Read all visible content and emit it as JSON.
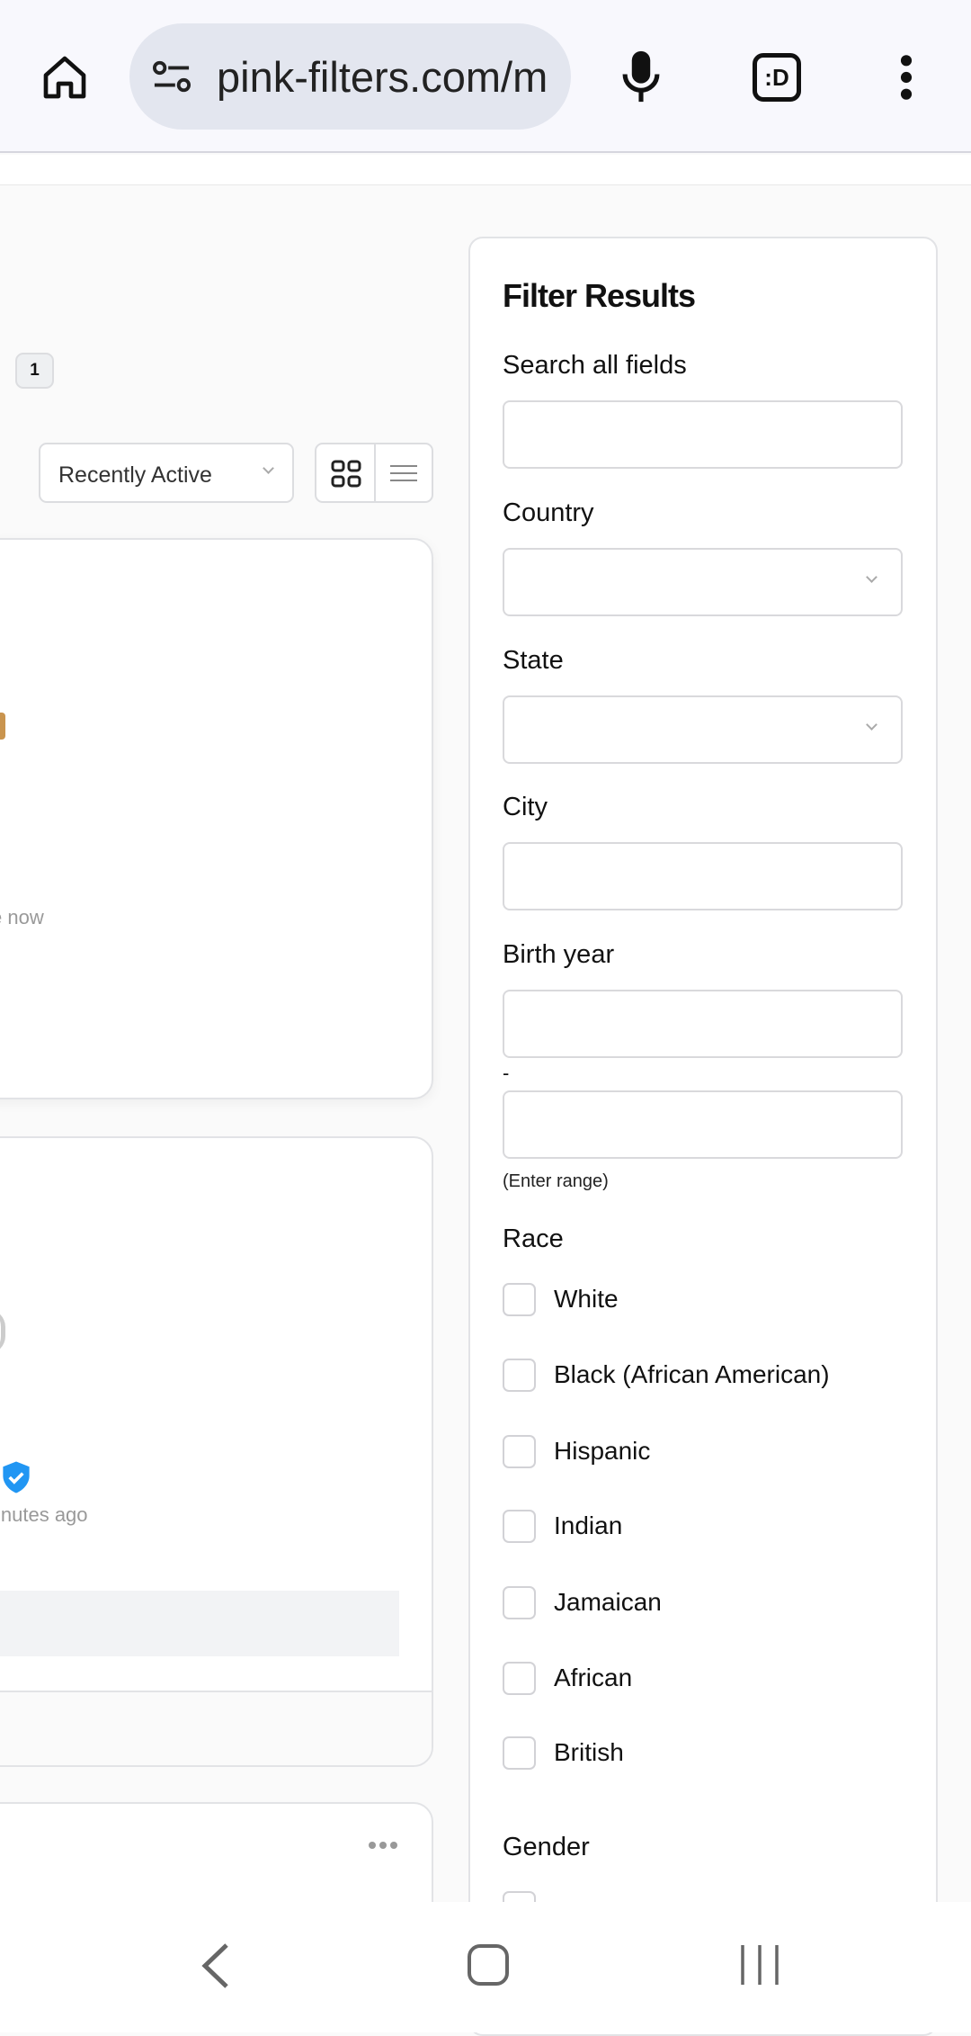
{
  "browser": {
    "url": "pink-filters.com/m",
    "icons": [
      "home-icon",
      "site-settings-icon",
      "mic-icon",
      "extension-icon",
      "more-menu-icon"
    ]
  },
  "results": {
    "count_badge": "1",
    "sort": {
      "selected": "Recently Active"
    },
    "view_toggle": [
      "grid-view-icon",
      "list-view-icon"
    ],
    "cards": [
      {
        "status_fragment": "e now"
      },
      {
        "status_fragment": "inutes ago",
        "verified": true
      },
      {
        "menu": "more-icon"
      }
    ]
  },
  "filter": {
    "title": "Filter Results",
    "search_label": "Search all fields",
    "search_value": "",
    "country_label": "Country",
    "country_value": "",
    "state_label": "State",
    "state_value": "",
    "city_label": "City",
    "city_value": "",
    "birth_year_label": "Birth year",
    "birth_from": "",
    "range_sep": "-",
    "birth_to": "",
    "range_hint": "(Enter range)",
    "race_label": "Race",
    "race_options": [
      {
        "label": "White",
        "checked": false
      },
      {
        "label": "Black (African American)",
        "checked": false
      },
      {
        "label": "Hispanic",
        "checked": false
      },
      {
        "label": "Indian",
        "checked": false
      },
      {
        "label": "Jamaican",
        "checked": false
      },
      {
        "label": "African",
        "checked": false
      },
      {
        "label": "British",
        "checked": false
      }
    ],
    "gender_label": "Gender"
  },
  "colors": {
    "verified": "#2196f3",
    "topbar": "#f8f8fd",
    "url_pill": "#e3e6ef"
  }
}
